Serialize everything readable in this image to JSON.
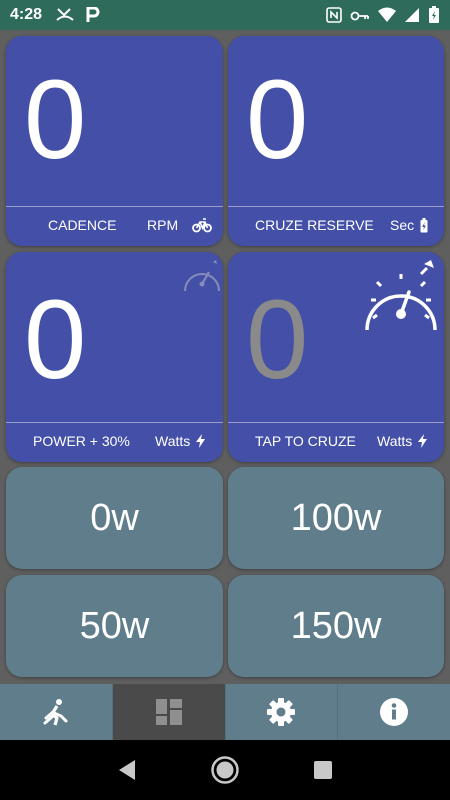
{
  "status": {
    "time": "4:28"
  },
  "cards": {
    "cadence": {
      "value": "0",
      "label": "CADENCE",
      "unit": "RPM"
    },
    "reserve": {
      "value": "0",
      "label": "CRUZE RESERVE",
      "unit": "Sec"
    },
    "power": {
      "value": "0",
      "label": "POWER + 30%",
      "unit": "Watts"
    },
    "cruze": {
      "value": "0",
      "label": "TAP TO CRUZE",
      "unit": "Watts"
    }
  },
  "watt_buttons": {
    "b0": "0w",
    "b100": "100w",
    "b50": "50w",
    "b150": "150w"
  },
  "tabs": {
    "icons": [
      "walker-icon",
      "dashboard-icon",
      "gear-icon",
      "info-icon"
    ]
  }
}
